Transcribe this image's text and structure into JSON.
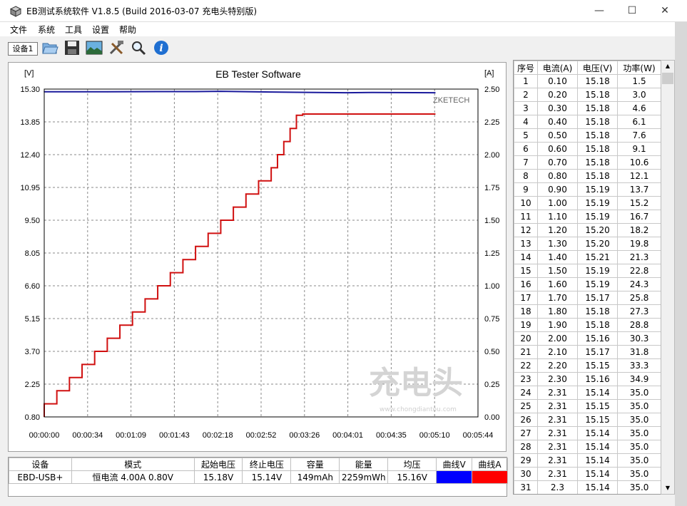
{
  "window": {
    "title": "EB测试系统软件 V1.8.5 (Build 2016-03-07 充电头特别版)"
  },
  "menu": [
    "文件",
    "系统",
    "工具",
    "设置",
    "帮助"
  ],
  "toolbar": {
    "device_tab": "设备1",
    "icons": [
      "open-folder-icon",
      "save-icon",
      "chart-image-icon",
      "tools-icon",
      "search-icon",
      "info-icon"
    ]
  },
  "chart_data": {
    "type": "line",
    "title": "EB Tester Software",
    "watermark": "ZKETECH",
    "y_left_unit": "[V]",
    "y_right_unit": "[A]",
    "y_left_ticks": [
      "15.30",
      "13.85",
      "12.40",
      "10.95",
      "9.50",
      "8.05",
      "6.60",
      "5.15",
      "3.70",
      "2.25",
      "0.80"
    ],
    "y_right_ticks": [
      "2.50",
      "2.25",
      "2.00",
      "1.75",
      "1.50",
      "1.25",
      "1.00",
      "0.75",
      "0.50",
      "0.25",
      "0.00"
    ],
    "x_ticks": [
      "00:00:00",
      "00:00:34",
      "00:01:09",
      "00:01:43",
      "00:02:18",
      "00:02:52",
      "00:03:26",
      "00:04:01",
      "00:04:35",
      "00:05:10",
      "00:05:44"
    ],
    "ylim_left": [
      0.8,
      15.3
    ],
    "ylim_right": [
      0,
      2.5
    ],
    "xlim_seconds": [
      0,
      344
    ],
    "grid": true,
    "series": [
      {
        "axis": "left",
        "color": "#1a1a9c",
        "x": [
          0,
          50,
          90,
          120,
          140,
          180,
          200,
          240,
          260,
          310
        ],
        "values": [
          15.18,
          15.18,
          15.19,
          15.19,
          15.2,
          15.17,
          15.16,
          15.14,
          15.15,
          15.14
        ]
      },
      {
        "axis": "right",
        "color": "#d01010",
        "x": [
          0,
          10,
          20,
          30,
          40,
          50,
          60,
          70,
          80,
          90,
          100,
          110,
          120,
          130,
          140,
          150,
          160,
          170,
          180,
          185,
          190,
          195,
          200,
          205,
          210,
          215,
          310
        ],
        "values": [
          0.1,
          0.2,
          0.3,
          0.4,
          0.5,
          0.6,
          0.7,
          0.8,
          0.9,
          1.0,
          1.1,
          1.2,
          1.3,
          1.4,
          1.5,
          1.6,
          1.7,
          1.8,
          1.9,
          2.0,
          2.1,
          2.2,
          2.3,
          2.31,
          2.31,
          2.31,
          2.31
        ]
      }
    ]
  },
  "readings": {
    "headers": [
      "序号",
      "电流(A)",
      "电压(V)",
      "功率(W)"
    ],
    "rows": [
      [
        "1",
        "0.10",
        "15.18",
        "1.5"
      ],
      [
        "2",
        "0.20",
        "15.18",
        "3.0"
      ],
      [
        "3",
        "0.30",
        "15.18",
        "4.6"
      ],
      [
        "4",
        "0.40",
        "15.18",
        "6.1"
      ],
      [
        "5",
        "0.50",
        "15.18",
        "7.6"
      ],
      [
        "6",
        "0.60",
        "15.18",
        "9.1"
      ],
      [
        "7",
        "0.70",
        "15.18",
        "10.6"
      ],
      [
        "8",
        "0.80",
        "15.18",
        "12.1"
      ],
      [
        "9",
        "0.90",
        "15.19",
        "13.7"
      ],
      [
        "10",
        "1.00",
        "15.19",
        "15.2"
      ],
      [
        "11",
        "1.10",
        "15.19",
        "16.7"
      ],
      [
        "12",
        "1.20",
        "15.20",
        "18.2"
      ],
      [
        "13",
        "1.30",
        "15.20",
        "19.8"
      ],
      [
        "14",
        "1.40",
        "15.21",
        "21.3"
      ],
      [
        "15",
        "1.50",
        "15.19",
        "22.8"
      ],
      [
        "16",
        "1.60",
        "15.19",
        "24.3"
      ],
      [
        "17",
        "1.70",
        "15.17",
        "25.8"
      ],
      [
        "18",
        "1.80",
        "15.18",
        "27.3"
      ],
      [
        "19",
        "1.90",
        "15.18",
        "28.8"
      ],
      [
        "20",
        "2.00",
        "15.16",
        "30.3"
      ],
      [
        "21",
        "2.10",
        "15.17",
        "31.8"
      ],
      [
        "22",
        "2.20",
        "15.15",
        "33.3"
      ],
      [
        "23",
        "2.30",
        "15.16",
        "34.9"
      ],
      [
        "24",
        "2.31",
        "15.14",
        "35.0"
      ],
      [
        "25",
        "2.31",
        "15.15",
        "35.0"
      ],
      [
        "26",
        "2.31",
        "15.15",
        "35.0"
      ],
      [
        "27",
        "2.31",
        "15.14",
        "35.0"
      ],
      [
        "28",
        "2.31",
        "15.14",
        "35.0"
      ],
      [
        "29",
        "2.31",
        "15.14",
        "35.0"
      ],
      [
        "30",
        "2.31",
        "15.14",
        "35.0"
      ],
      [
        "31",
        "2.3",
        "15.14",
        "35.0"
      ]
    ]
  },
  "summary": {
    "headers": [
      "设备",
      "模式",
      "起始电压",
      "终止电压",
      "容量",
      "能量",
      "均压",
      "曲线V",
      "曲线A"
    ],
    "values": [
      "EBD-USB+",
      "恒电流  4.00A  0.80V",
      "15.18V",
      "15.14V",
      "149mAh",
      "2259mWh",
      "15.16V"
    ],
    "colors": {
      "curve_v": "#0000ff",
      "curve_a": "#ff0000"
    }
  }
}
